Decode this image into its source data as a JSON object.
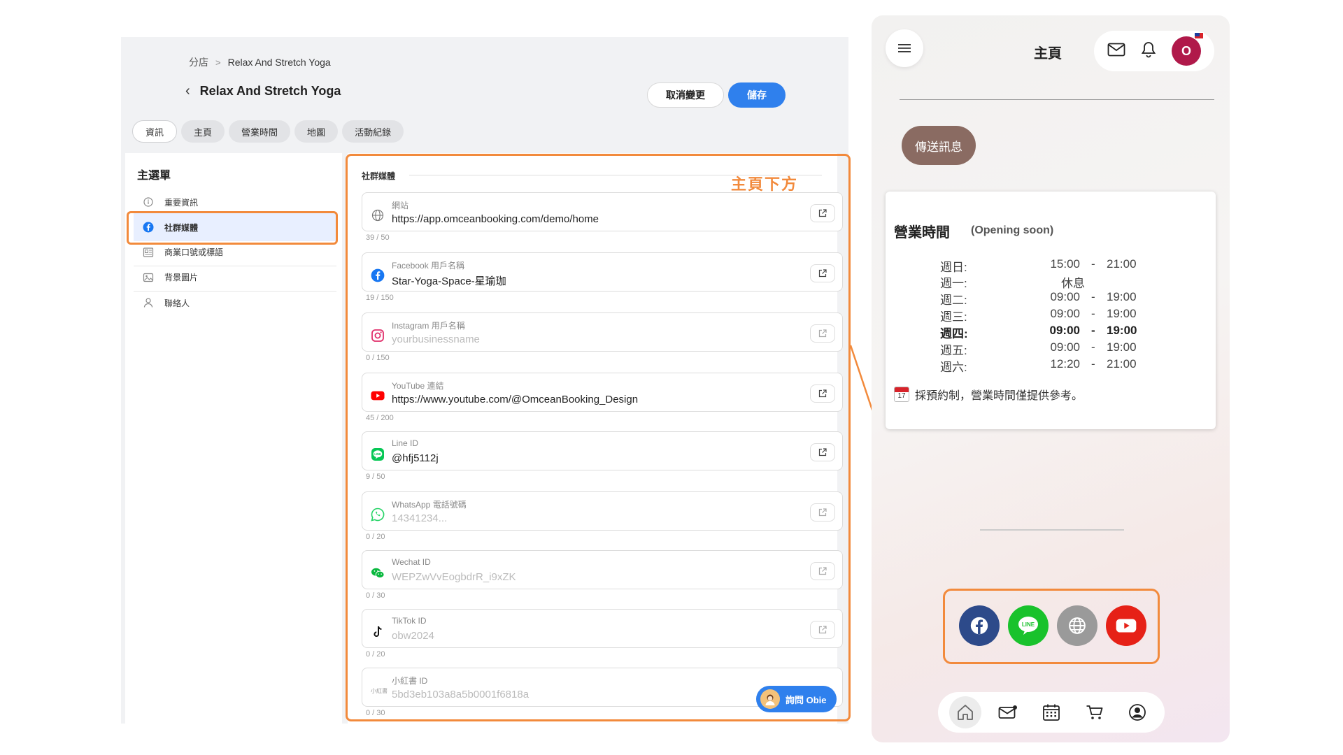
{
  "admin": {
    "breadcrumb": {
      "parent": "分店",
      "separator": ">",
      "current": "Relax And Stretch Yoga"
    },
    "title": "Relax And Stretch Yoga",
    "buttons": {
      "cancel": "取消變更",
      "save": "儲存"
    },
    "tabs": [
      "資訊",
      "主頁",
      "營業時間",
      "地圖",
      "活動紀錄"
    ],
    "active_tab": "資訊",
    "sidebar": {
      "title": "主選單",
      "items": [
        {
          "label": "重要資訊",
          "icon": "info-icon"
        },
        {
          "label": "社群媒體",
          "icon": "facebook-icon",
          "active": true
        },
        {
          "label": "商業口號或標語",
          "icon": "slogan-icon"
        },
        {
          "label": "背景圖片",
          "icon": "image-icon"
        },
        {
          "label": "聯絡人",
          "icon": "person-icon"
        }
      ]
    },
    "section_title": "社群媒體",
    "annotation": "主頁下方",
    "fields": [
      {
        "label": "網站",
        "value": "https://app.omceanbooking.com/demo/home",
        "placeholder": false,
        "counter": "39 / 50",
        "icon": "globe-icon"
      },
      {
        "label": "Facebook 用戶名稱",
        "value": "Star-Yoga-Space-星瑜珈",
        "placeholder": false,
        "counter": "19 / 150",
        "icon": "facebook-icon"
      },
      {
        "label": "Instagram 用戶名稱",
        "value": "yourbusinessname",
        "placeholder": true,
        "counter": "0 / 150",
        "icon": "instagram-icon"
      },
      {
        "label": "YouTube 連結",
        "value": "https://www.youtube.com/@OmceanBooking_Design",
        "placeholder": false,
        "counter": "45 / 200",
        "icon": "youtube-icon"
      },
      {
        "label": "Line ID",
        "value": "@hfj5112j",
        "placeholder": false,
        "counter": "9 / 50",
        "icon": "line-icon"
      },
      {
        "label": "WhatsApp 電話號碼",
        "value": "14341234...",
        "placeholder": true,
        "counter": "0 / 20",
        "icon": "whatsapp-icon"
      },
      {
        "label": "Wechat ID",
        "value": "WEPZwVvEogbdrR_i9xZK",
        "placeholder": true,
        "counter": "0 / 30",
        "icon": "wechat-icon"
      },
      {
        "label": "TikTok ID",
        "value": "obw2024",
        "placeholder": true,
        "counter": "0 / 20",
        "icon": "tiktok-icon"
      },
      {
        "label": "小紅書 ID",
        "value": "5bd3eb103a8a5b0001f6818a",
        "placeholder": true,
        "counter": "0 / 30",
        "icon": "xiaohongshu-icon"
      }
    ],
    "xiaohongshu_icon_text": "小紅書",
    "ask_obie": "詢問 Obie"
  },
  "phone": {
    "title": "主頁",
    "avatar_initial": "O",
    "send_message": "傳送訊息",
    "hours": {
      "title": "營業時間",
      "status": "(Opening soon)",
      "closed_label": "休息",
      "dash": "-",
      "rows": [
        {
          "day": "週日:",
          "open": "15:00",
          "close": "21:00"
        },
        {
          "day": "週一:",
          "closed": true
        },
        {
          "day": "週二:",
          "open": "09:00",
          "close": "19:00"
        },
        {
          "day": "週三:",
          "open": "09:00",
          "close": "19:00"
        },
        {
          "day": "週四:",
          "open": "09:00",
          "close": "19:00",
          "today": true
        },
        {
          "day": "週五:",
          "open": "09:00",
          "close": "19:00"
        },
        {
          "day": "週六:",
          "open": "12:20",
          "close": "21:00"
        }
      ],
      "calendar_day": "17",
      "note": "採預約制，營業時間僅提供參考。"
    },
    "social_icons": [
      {
        "icon": "facebook-icon",
        "color": "#2d4a8a"
      },
      {
        "icon": "line-icon",
        "color": "#19c22c"
      },
      {
        "icon": "globe-icon",
        "color": "#9a9a9a"
      },
      {
        "icon": "youtube-icon",
        "color": "#e62117"
      }
    ],
    "bottom_nav": [
      "home-icon",
      "mail-icon",
      "calendar-icon",
      "cart-icon",
      "profile-icon"
    ]
  },
  "colors": {
    "accent_orange": "#f28a3c",
    "primary_blue": "#2f80ed"
  }
}
